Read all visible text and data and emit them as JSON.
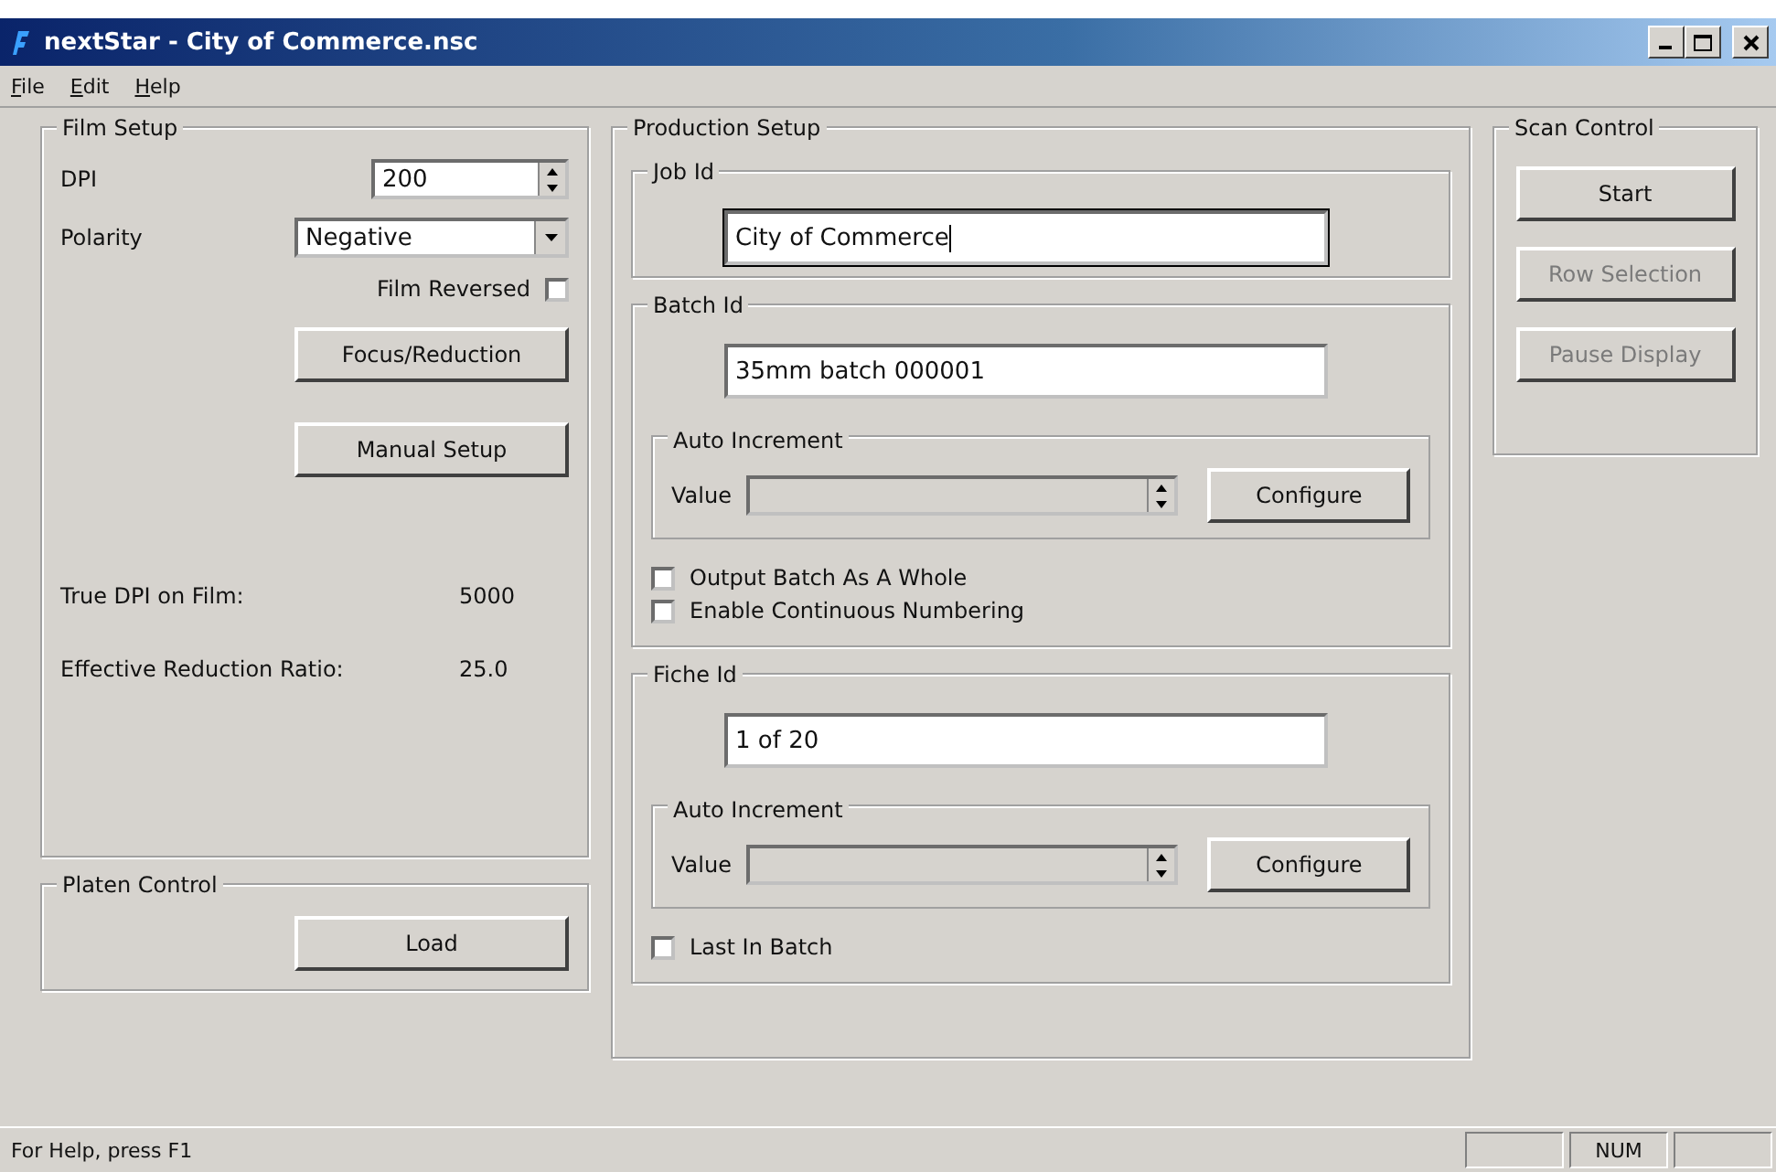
{
  "window": {
    "title": "nextStar - City of Commerce.nsc"
  },
  "menu": [
    {
      "label": "File"
    },
    {
      "label": "Edit"
    },
    {
      "label": "Help"
    }
  ],
  "film_setup": {
    "title": "Film Setup",
    "dpi": {
      "label": "DPI",
      "value": "200"
    },
    "polarity": {
      "label": "Polarity",
      "value": "Negative"
    },
    "film_reversed": {
      "label": "Film Reversed",
      "checked": false
    },
    "buttons": [
      {
        "label": "Focus/Reduction"
      },
      {
        "label": "Manual Setup"
      }
    ],
    "readouts": [
      {
        "label": "True DPI on Film:",
        "value": "5000"
      },
      {
        "label": "Effective Reduction Ratio:",
        "value": "25.0"
      }
    ]
  },
  "platen_control": {
    "title": "Platen Control",
    "button": "Load"
  },
  "production_setup": {
    "title": "Production Setup",
    "groups": [
      {
        "title": "Job Id",
        "value": "City of Commerce",
        "focused": true
      },
      {
        "title": "Batch Id",
        "value": "35mm batch 000001",
        "focused": false,
        "auto_increment": {
          "title": "Auto Increment",
          "label": "Value",
          "disabled": true,
          "button": "Configure"
        },
        "options": [
          {
            "label": "Output Batch As A Whole",
            "checked": false
          },
          {
            "label": "Enable Continuous Numbering",
            "checked": false
          }
        ]
      },
      {
        "title": "Fiche Id",
        "value": "1 of 20",
        "focused": false,
        "auto_increment": {
          "title": "Auto Increment",
          "label": "Value",
          "disabled": true,
          "button": "Configure"
        },
        "options": [
          {
            "label": "Last In Batch",
            "checked": false
          }
        ]
      }
    ]
  },
  "scan_control": {
    "title": "Scan Control",
    "buttons": [
      {
        "label": "Start",
        "disabled": false
      },
      {
        "label": "Row Selection",
        "disabled": true
      },
      {
        "label": "Pause Display",
        "disabled": true
      }
    ]
  },
  "status_bar": {
    "text": "For Help, press F1",
    "indicator": "NUM"
  }
}
